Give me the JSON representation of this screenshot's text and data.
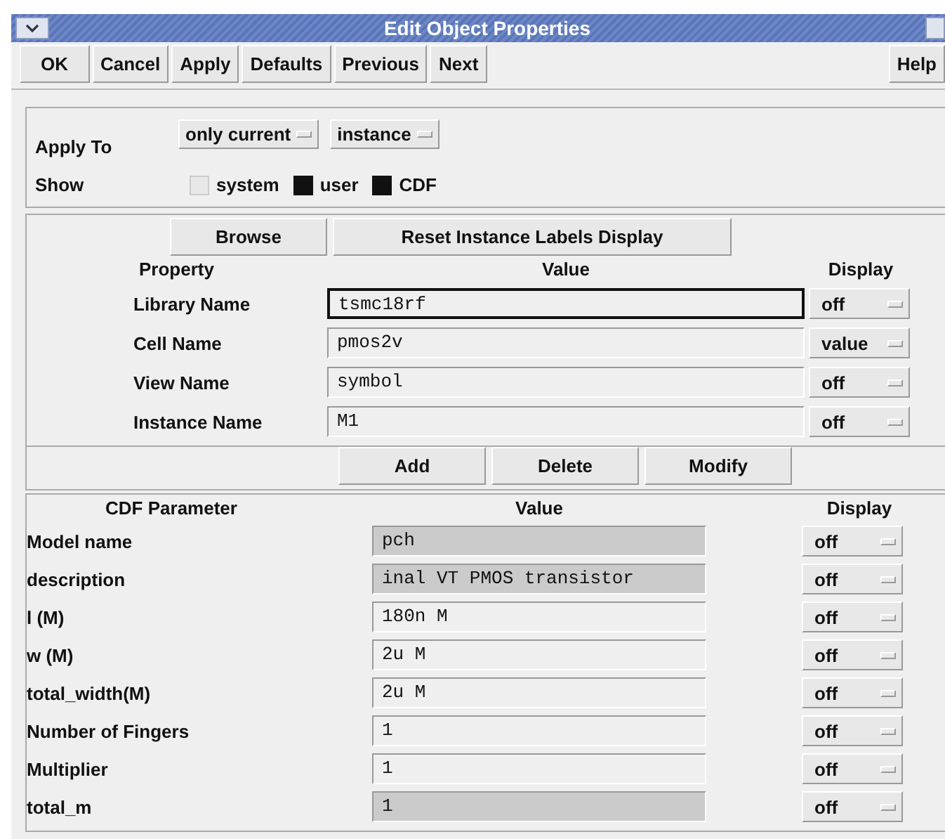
{
  "window": {
    "title": "Edit Object Properties"
  },
  "toolbar": {
    "buttons": [
      "OK",
      "Cancel",
      "Apply",
      "Defaults",
      "Previous",
      "Next"
    ],
    "help": "Help"
  },
  "apply_to": {
    "label": "Apply To",
    "menus": [
      "only current",
      "instance"
    ]
  },
  "show": {
    "label": "Show",
    "options": [
      {
        "label": "system",
        "checked": false
      },
      {
        "label": "user",
        "checked": true
      },
      {
        "label": "CDF",
        "checked": true
      }
    ]
  },
  "property_section": {
    "buttons": [
      "Browse",
      "Reset Instance Labels Display"
    ],
    "columns": [
      "Property",
      "Value",
      "Display"
    ],
    "rows": [
      {
        "name": "Library Name",
        "value": "tsmc18rf",
        "focused": true,
        "display": "off"
      },
      {
        "name": "Cell Name",
        "value": "pmos2v",
        "focused": false,
        "display": "value"
      },
      {
        "name": "View Name",
        "value": "symbol",
        "focused": false,
        "display": "off"
      },
      {
        "name": "Instance Name",
        "value": "M1",
        "focused": false,
        "display": "off"
      }
    ]
  },
  "edit_buttons": [
    "Add",
    "Delete",
    "Modify"
  ],
  "cdf_section": {
    "columns": [
      "CDF Parameter",
      "Value",
      "Display"
    ],
    "rows": [
      {
        "name": "Model name",
        "value": "pch",
        "editable": false,
        "display": "off"
      },
      {
        "name": "description",
        "value": "inal VT PMOS transistor",
        "editable": false,
        "display": "off"
      },
      {
        "name": "l (M)",
        "value": "180n M",
        "editable": true,
        "display": "off"
      },
      {
        "name": "w (M)",
        "value": "2u M",
        "editable": true,
        "display": "off"
      },
      {
        "name": "total_width(M)",
        "value": "2u M",
        "editable": true,
        "display": "off"
      },
      {
        "name": "Number of Fingers",
        "value": "1",
        "editable": true,
        "display": "off"
      },
      {
        "name": "Multiplier",
        "value": "1",
        "editable": true,
        "display": "off"
      },
      {
        "name": "total_m",
        "value": "1",
        "editable": false,
        "display": "off"
      }
    ]
  }
}
